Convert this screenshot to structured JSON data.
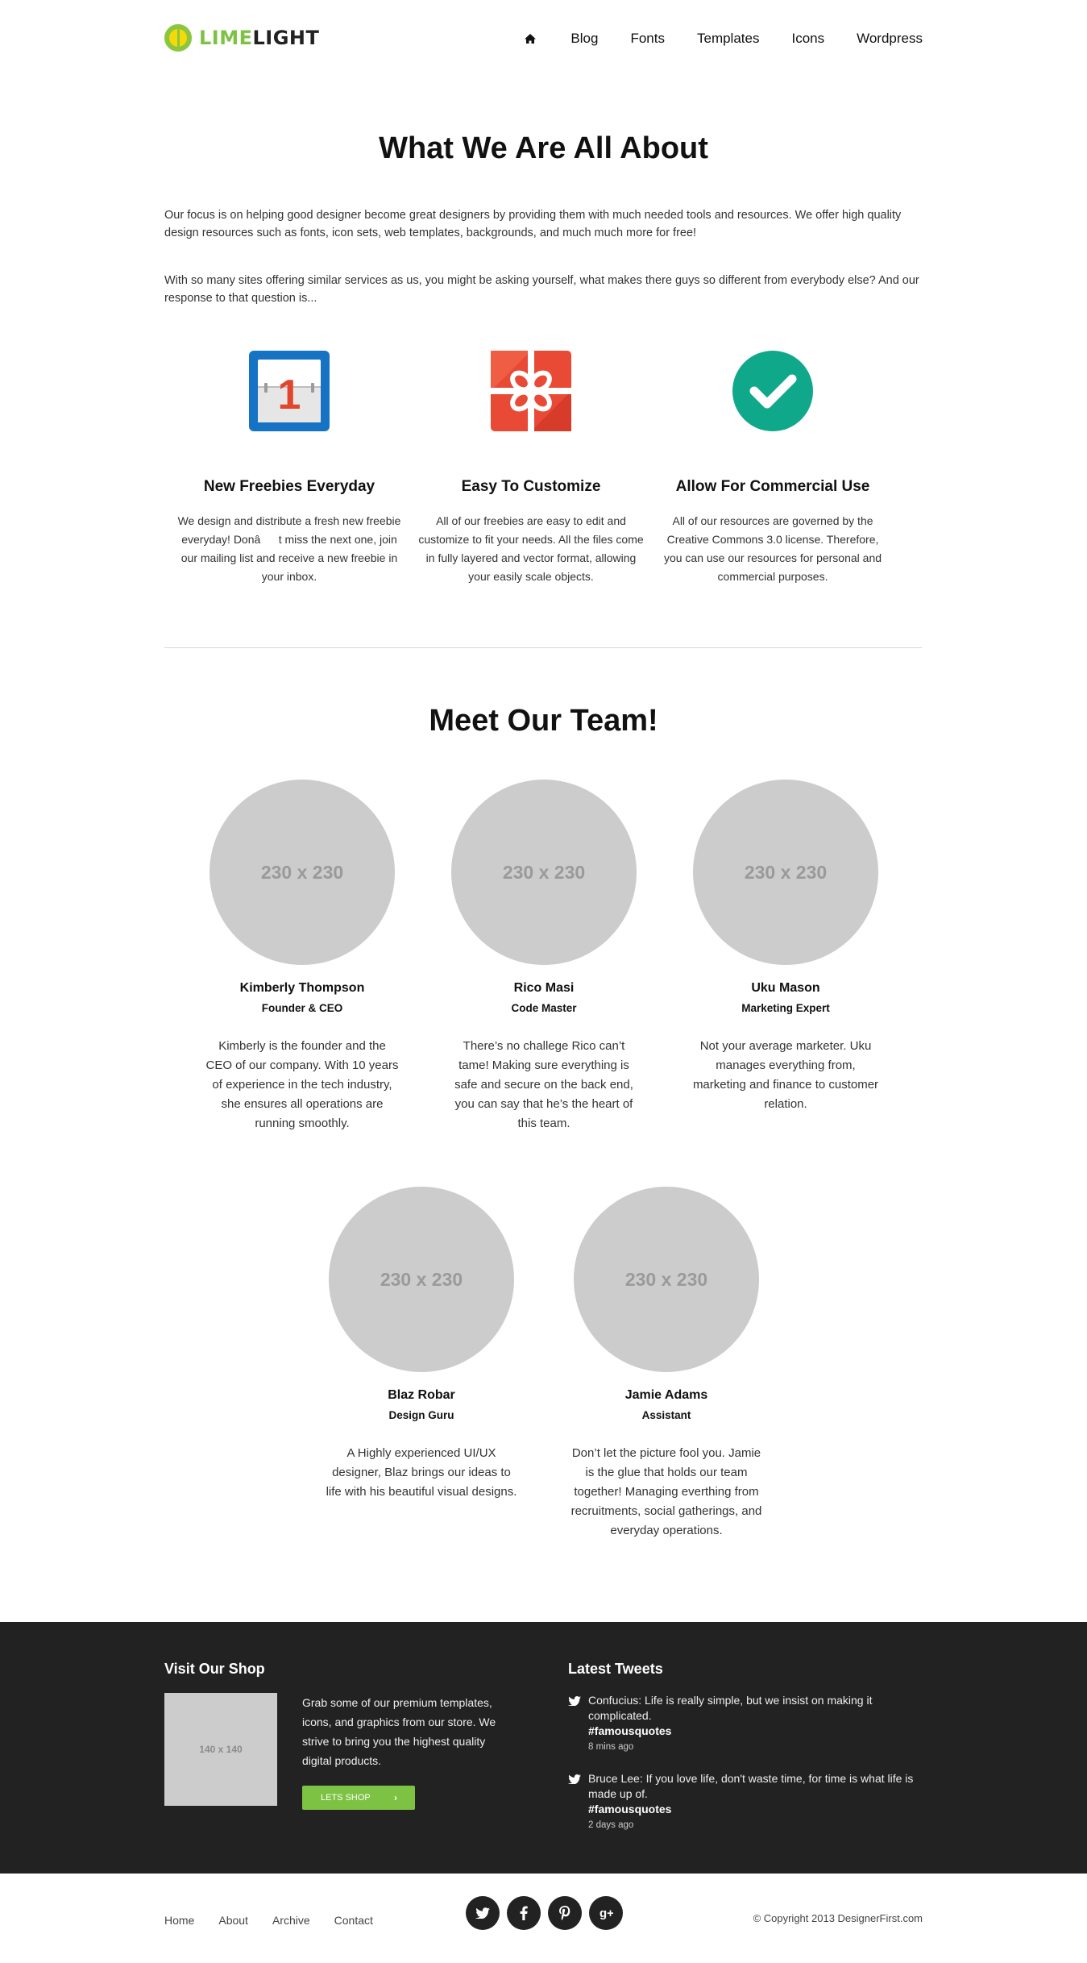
{
  "header": {
    "logo_lime": "LIME",
    "logo_light": "LIGHT",
    "nav": [
      "Blog",
      "Fonts",
      "Templates",
      "Icons",
      "Wordpress"
    ]
  },
  "about": {
    "title": "What We Are All About",
    "paragraph1": "Our focus is on helping good designer become great designers by providing them with much needed tools and resources. We offer high quality design resources such as fonts, icon sets, web templates, backgrounds, and much much more for free!",
    "paragraph2": "With so many sites offering similar services as us, you might be asking yourself, what makes there guys so different from everybody else? And our response to that question is...",
    "features": [
      {
        "icon": "calendar-icon",
        "calendar_day": "1",
        "title": "New Freebies Everyday",
        "text": "We design and distribute a fresh new freebie everyday! Donât miss the next one, join our mailing list and receive a new freebie in your inbox."
      },
      {
        "icon": "gift-icon",
        "title": "Easy To Customize",
        "text": "All of our freebies are easy to edit and customize to fit your needs. All the files come in fully layered and vector format, allowing your easily scale objects."
      },
      {
        "icon": "checkmark-icon",
        "title": "Allow For Commercial Use",
        "text": "All of our resources are governed by the Creative Commons 3.0 license. Therefore, you can use our resources for personal and commercial purposes."
      }
    ]
  },
  "team": {
    "title": "Meet Our Team!",
    "members": [
      {
        "photo": "230 x 230",
        "name": "Kimberly Thompson",
        "role": "Founder & CEO",
        "bio": "Kimberly is the founder and the CEO of our company. With 10 years of experience in the tech industry, she ensures all operations are running smoothly."
      },
      {
        "photo": "230 x 230",
        "name": "Rico Masi",
        "role": "Code Master",
        "bio": "There’s no challege Rico can’t tame! Making sure everything is safe and secure on the back end, you can say that he’s the heart of this team."
      },
      {
        "photo": "230 x 230",
        "name": "Uku Mason",
        "role": "Marketing Expert",
        "bio": "Not your average marketer. Uku manages everything from, marketing and finance to customer relation."
      },
      {
        "photo": "230 x 230",
        "name": "Blaz Robar",
        "role": "Design Guru",
        "bio": "A Highly experienced UI/UX designer, Blaz brings our ideas to life with his beautiful visual designs."
      },
      {
        "photo": "230 x 230",
        "name": "Jamie Adams",
        "role": "Assistant",
        "bio": "Don’t let the picture fool you. Jamie is the glue that holds our team together! Managing everthing from recruitments, social gatherings, and everyday operations."
      }
    ]
  },
  "footer": {
    "shop_title": "Visit Our Shop",
    "shop_image": "140 x 140",
    "shop_text": "Grab some of our premium templates, icons, and graphics from our store. We strive to bring you the highest quality digital products.",
    "shop_button": "LETS SHOP",
    "tweets_title": "Latest Tweets",
    "tweets": [
      {
        "text": "Confucius: Life is really simple, but we insist on making it complicated.",
        "tag": "#famousquotes",
        "time": "8 mins ago"
      },
      {
        "text": "Bruce Lee: If you love life, don't waste time, for time is what life is made up of.",
        "tag": "#famousquotes",
        "time": "2 days ago"
      }
    ]
  },
  "bottom": {
    "links": [
      "Home",
      "About",
      "Archive",
      "Contact"
    ],
    "social": [
      "twitter-icon",
      "facebook-icon",
      "pinterest-icon",
      "google-plus-icon"
    ],
    "copyright": "© Copyright 2013 DesignerFirst.com"
  },
  "colors": {
    "accent": "#7dc242",
    "footer_bg": "#222222",
    "placeholder": "#cccccc"
  }
}
